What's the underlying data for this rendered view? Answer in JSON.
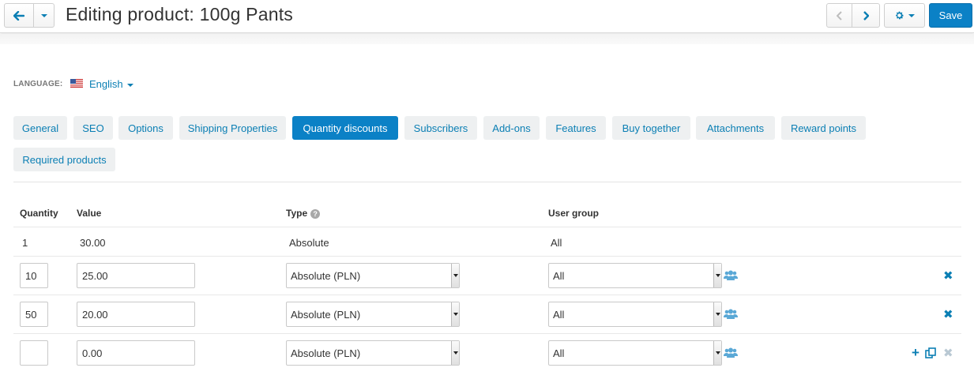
{
  "header": {
    "title": "Editing product: 100g Pants",
    "save_label": "Save"
  },
  "language": {
    "label": "LANGUAGE:",
    "value": "English"
  },
  "tabs": [
    {
      "label": "General",
      "active": false
    },
    {
      "label": "SEO",
      "active": false
    },
    {
      "label": "Options",
      "active": false
    },
    {
      "label": "Shipping Properties",
      "active": false
    },
    {
      "label": "Quantity discounts",
      "active": true
    },
    {
      "label": "Subscribers",
      "active": false
    },
    {
      "label": "Add-ons",
      "active": false
    },
    {
      "label": "Features",
      "active": false
    },
    {
      "label": "Buy together",
      "active": false
    },
    {
      "label": "Attachments",
      "active": false
    },
    {
      "label": "Reward points",
      "active": false
    },
    {
      "label": "Required products",
      "active": false
    }
  ],
  "table": {
    "headers": {
      "quantity": "Quantity",
      "value": "Value",
      "type": "Type",
      "user_group": "User group"
    },
    "static_row": {
      "quantity": "1",
      "value": "30.00",
      "type": "Absolute",
      "user_group": "All"
    },
    "rows": [
      {
        "quantity": "10",
        "value": "25.00",
        "type": "Absolute (PLN)",
        "user_group": "All"
      },
      {
        "quantity": "50",
        "value": "20.00",
        "type": "Absolute (PLN)",
        "user_group": "All"
      },
      {
        "quantity": "",
        "value": "0.00",
        "type": "Absolute (PLN)",
        "user_group": "All"
      }
    ]
  },
  "icons": {
    "back": "arrow-left-icon",
    "prev": "chevron-left-icon",
    "next": "chevron-right-icon",
    "settings": "gear-icon",
    "users": "users-icon",
    "remove": "remove-icon",
    "add": "plus-icon",
    "clone": "clone-icon",
    "help": "question-circle-icon"
  },
  "colors": {
    "accent": "#0b81c6",
    "link": "#0b7fb4",
    "tab_bg": "#eef0f1"
  }
}
